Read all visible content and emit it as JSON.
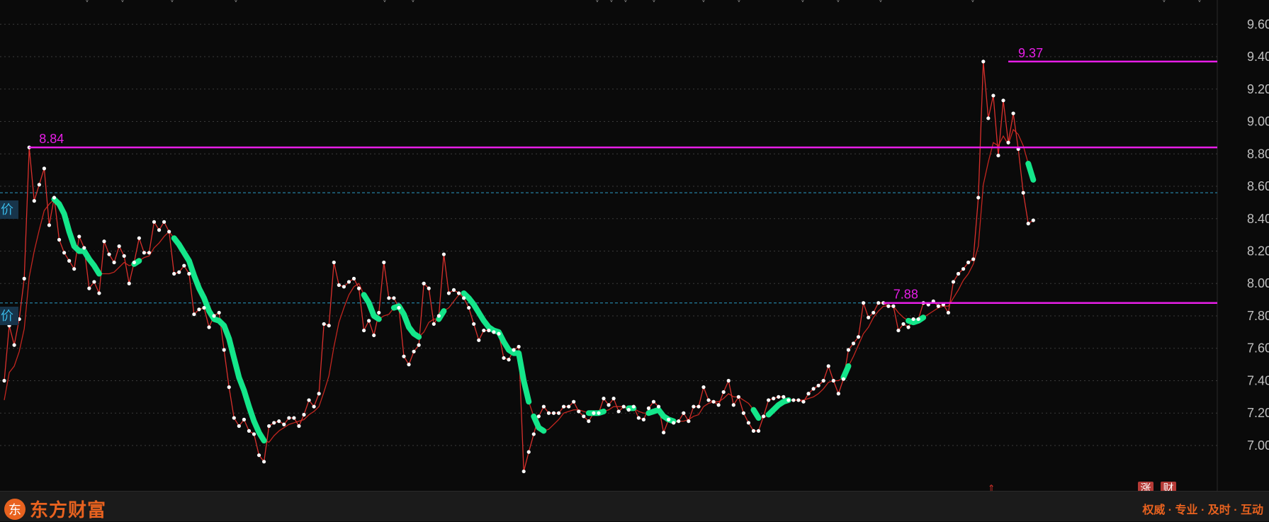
{
  "chart_data": {
    "type": "line",
    "title": "",
    "xlabel": "",
    "ylabel": "",
    "ylim": [
      6.72,
      9.75
    ],
    "y_ticks": [
      7.0,
      7.2,
      7.4,
      7.6,
      7.8,
      8.0,
      8.2,
      8.4,
      8.6,
      8.8,
      9.0,
      9.2,
      9.4,
      9.6
    ],
    "grid": true,
    "colors": {
      "background": "#0a0a0a",
      "price_line": "#d9302c",
      "price_points": "#ffffff",
      "ma_line": "#c2261f",
      "trend_segments": "#14e68a",
      "level_lines": "#e81ee8",
      "dashed_levels": "#2a9bc4",
      "axis_text": "#bfbfbf"
    },
    "series": [
      {
        "values": [
          7.4,
          7.74,
          7.62,
          7.78,
          8.03,
          8.84,
          8.51,
          8.61,
          8.71,
          8.36,
          8.53,
          8.27,
          8.19,
          8.14,
          8.09,
          8.29,
          8.22,
          7.97,
          8.01,
          7.94,
          8.26,
          8.18,
          8.13,
          8.23,
          8.17,
          8.0,
          8.13,
          8.28,
          8.19,
          8.19,
          8.38,
          8.33,
          8.38,
          8.32,
          8.06,
          8.07,
          8.11,
          8.06,
          7.81,
          7.84,
          7.85,
          7.73,
          7.8,
          7.82,
          7.59,
          7.36,
          7.17,
          7.12,
          7.16,
          7.09,
          7.07,
          6.94,
          6.9,
          7.12,
          7.14,
          7.15,
          7.13,
          7.17,
          7.17,
          7.12,
          7.19,
          7.28,
          7.24,
          7.32,
          7.75,
          7.74,
          8.13,
          7.99,
          7.98,
          8.01,
          8.03,
          7.97,
          7.71,
          7.77,
          7.68,
          7.82,
          8.13,
          7.91,
          7.91,
          7.85,
          7.55,
          7.5,
          7.58,
          7.62,
          8.0,
          7.97,
          7.75,
          7.8,
          8.18,
          7.94,
          7.96,
          7.94,
          7.91,
          7.85,
          7.75,
          7.65,
          7.71,
          7.71,
          7.7,
          7.69,
          7.54,
          7.53,
          7.59,
          7.61,
          6.84,
          6.96,
          7.07,
          7.18,
          7.24,
          7.2,
          7.2,
          7.2,
          7.24,
          7.24,
          7.27,
          7.21,
          7.18,
          7.15,
          7.2,
          7.2,
          7.29,
          7.25,
          7.29,
          7.21,
          7.24,
          7.22,
          7.24,
          7.17,
          7.16,
          7.23,
          7.27,
          7.24,
          7.08,
          7.16,
          7.14,
          7.15,
          7.2,
          7.15,
          7.24,
          7.24,
          7.36,
          7.28,
          7.27,
          7.25,
          7.33,
          7.4,
          7.25,
          7.3,
          7.2,
          7.14,
          7.09,
          7.09,
          7.18,
          7.28,
          7.29,
          7.3,
          7.3,
          7.28,
          7.28,
          7.28,
          7.27,
          7.32,
          7.35,
          7.37,
          7.4,
          7.49,
          7.4,
          7.32,
          7.41,
          7.59,
          7.63,
          7.67,
          7.88,
          7.79,
          7.82,
          7.88,
          7.88,
          7.86,
          7.86,
          7.71,
          7.75,
          7.73,
          7.78,
          7.78,
          7.88,
          7.87,
          7.89,
          7.86,
          7.87,
          7.82,
          8.01,
          8.06,
          8.09,
          8.13,
          8.15,
          8.53,
          9.37,
          9.02,
          9.16,
          8.79,
          9.13,
          8.87,
          9.05,
          8.83,
          8.56,
          8.37,
          8.39
        ]
      },
      {
        "values": [
          7.28,
          7.45,
          7.49,
          7.58,
          7.72,
          8.04,
          8.2,
          8.33,
          8.45,
          8.49,
          8.52,
          8.49,
          8.43,
          8.32,
          8.23,
          8.2,
          8.2,
          8.15,
          8.11,
          8.06,
          8.06,
          8.06,
          8.07,
          8.1,
          8.13,
          8.11,
          8.12,
          8.14,
          8.16,
          8.17,
          8.22,
          8.25,
          8.29,
          8.32,
          8.28,
          8.24,
          8.19,
          8.14,
          8.05,
          7.97,
          7.91,
          7.83,
          7.78,
          7.77,
          7.74,
          7.66,
          7.54,
          7.42,
          7.34,
          7.24,
          7.15,
          7.08,
          7.03,
          7.02,
          7.06,
          7.09,
          7.11,
          7.13,
          7.14,
          7.15,
          7.16,
          7.19,
          7.21,
          7.24,
          7.33,
          7.43,
          7.61,
          7.76,
          7.85,
          7.93,
          7.98,
          8.0,
          7.93,
          7.88,
          7.8,
          7.78,
          7.8,
          7.81,
          7.85,
          7.86,
          7.81,
          7.73,
          7.69,
          7.67,
          7.7,
          7.76,
          7.78,
          7.78,
          7.83,
          7.85,
          7.89,
          7.93,
          7.94,
          7.91,
          7.87,
          7.82,
          7.77,
          7.73,
          7.71,
          7.7,
          7.64,
          7.59,
          7.57,
          7.57,
          7.4,
          7.27,
          7.18,
          7.11,
          7.09,
          7.1,
          7.13,
          7.16,
          7.2,
          7.21,
          7.22,
          7.22,
          7.21,
          7.2,
          7.2,
          7.2,
          7.21,
          7.22,
          7.24,
          7.24,
          7.24,
          7.23,
          7.23,
          7.21,
          7.2,
          7.2,
          7.21,
          7.22,
          7.18,
          7.16,
          7.15,
          7.15,
          7.15,
          7.16,
          7.18,
          7.19,
          7.24,
          7.26,
          7.27,
          7.27,
          7.29,
          7.32,
          7.3,
          7.3,
          7.28,
          7.26,
          7.22,
          7.17,
          7.17,
          7.19,
          7.22,
          7.25,
          7.27,
          7.28,
          7.28,
          7.28,
          7.28,
          7.29,
          7.3,
          7.32,
          7.35,
          7.39,
          7.4,
          7.4,
          7.42,
          7.49,
          7.55,
          7.62,
          7.69,
          7.73,
          7.79,
          7.83,
          7.86,
          7.86,
          7.86,
          7.82,
          7.79,
          7.77,
          7.76,
          7.77,
          7.79,
          7.81,
          7.83,
          7.85,
          7.86,
          7.86,
          7.91,
          7.96,
          8.02,
          8.06,
          8.12,
          8.23,
          8.61,
          8.75,
          8.87,
          8.85,
          8.91,
          8.86,
          8.95,
          8.92,
          8.85,
          8.74,
          8.64
        ]
      }
    ],
    "trend_segments": [
      [
        10,
        17
      ],
      [
        15,
        19
      ],
      [
        26,
        27
      ],
      [
        34,
        52
      ],
      [
        72,
        75
      ],
      [
        78,
        83
      ],
      [
        87,
        88
      ],
      [
        92,
        105
      ],
      [
        106,
        108
      ],
      [
        117,
        120
      ],
      [
        125,
        126
      ],
      [
        129,
        134
      ],
      [
        150,
        151
      ],
      [
        153,
        157
      ],
      [
        168,
        169
      ],
      [
        181,
        184
      ],
      [
        205,
        209
      ]
    ],
    "levels": [
      {
        "value": 8.84,
        "label": "8.84",
        "start_index": 5
      },
      {
        "value": 7.88,
        "label": "7.88",
        "start_index": 176
      },
      {
        "value": 9.37,
        "label": "9.37",
        "start_index": 201
      }
    ],
    "dashed_levels": [
      8.56,
      7.88
    ],
    "left_tags": [
      "价",
      "价"
    ]
  },
  "footer": {
    "brand_logo": "东",
    "brand_name": "东方财富",
    "slogan": "权威 · 专业 · 及时 · 互动",
    "badges": [
      "涨",
      "财"
    ]
  }
}
